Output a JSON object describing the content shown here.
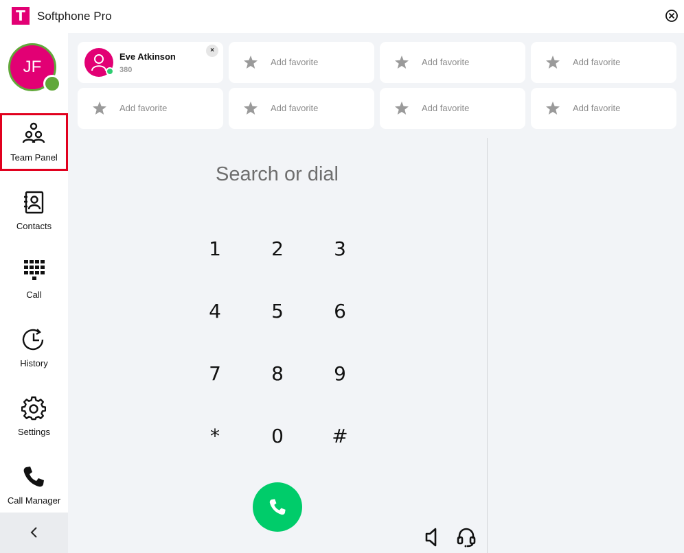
{
  "app": {
    "logo_text": "T",
    "title": "Softphone Pro",
    "brand_color": "#e20074"
  },
  "user": {
    "initials": "JF",
    "presence_color": "#61a83a"
  },
  "sidebar": {
    "items": [
      {
        "label": "Team Panel",
        "icon": "team-icon",
        "selected": true
      },
      {
        "label": "Contacts",
        "icon": "contact-book-icon"
      },
      {
        "label": "Call",
        "icon": "dialpad-icon"
      },
      {
        "label": "History",
        "icon": "history-clock-icon"
      },
      {
        "label": "Settings",
        "icon": "gear-icon"
      },
      {
        "label": "Call Manager",
        "icon": "phone-icon"
      }
    ],
    "collapse_icon": "chevron-left-icon"
  },
  "favorites": {
    "contact": {
      "name": "Eve Atkinson",
      "extension": "380",
      "status_color": "#2ecc71",
      "remove_label": "×"
    },
    "empty_label": "Add favorite"
  },
  "dialer": {
    "placeholder": "Search or dial",
    "keys": [
      "1",
      "2",
      "3",
      "4",
      "5",
      "6",
      "7",
      "8",
      "9",
      "*",
      "0",
      "#"
    ],
    "call_color": "#00cc6a"
  }
}
